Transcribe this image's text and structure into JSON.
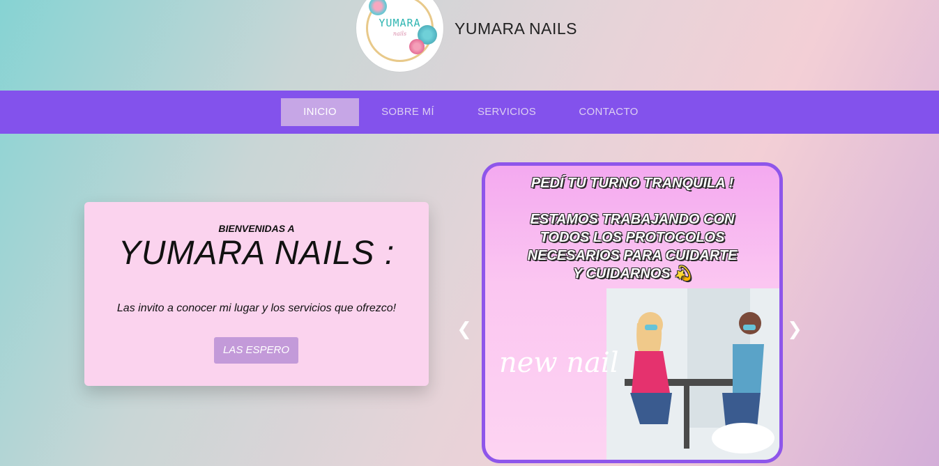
{
  "header": {
    "logo": {
      "text": "YUMARA",
      "subtext": "nails"
    },
    "site_name": "YUMARA NAILS"
  },
  "nav": {
    "items": [
      {
        "label": "INICIO",
        "active": true
      },
      {
        "label": "SOBRE MÍ",
        "active": false
      },
      {
        "label": "SERVICIOS",
        "active": false
      },
      {
        "label": "CONTACTO",
        "active": false
      }
    ]
  },
  "welcome": {
    "kicker": "BIENVENIDAS A",
    "title": "YUMARA NAILS :",
    "text": "Las invito a conocer mi lugar y los servicios que ofrezco!",
    "button": "LAS ESPERO"
  },
  "carousel": {
    "slide_heading": "PEDÍ TU TURNO TRANQUILA !",
    "slide_lines": [
      "ESTAMOS TRABAJANDO CON",
      "TODOS LOS PROTOCOLOS",
      "NECESARIOS PARA CUIDARTE",
      "Y CUIDARNOS 💫"
    ],
    "slide_script": "new nail",
    "prev_icon": "chevron-left-icon",
    "next_icon": "chevron-right-icon"
  },
  "colors": {
    "nav_bg": "#8352ec",
    "nav_active": "#c6a6e6",
    "card_bg": "#fbd3ee",
    "button_bg": "#c39ad9",
    "slide_border": "#8e56ea"
  }
}
